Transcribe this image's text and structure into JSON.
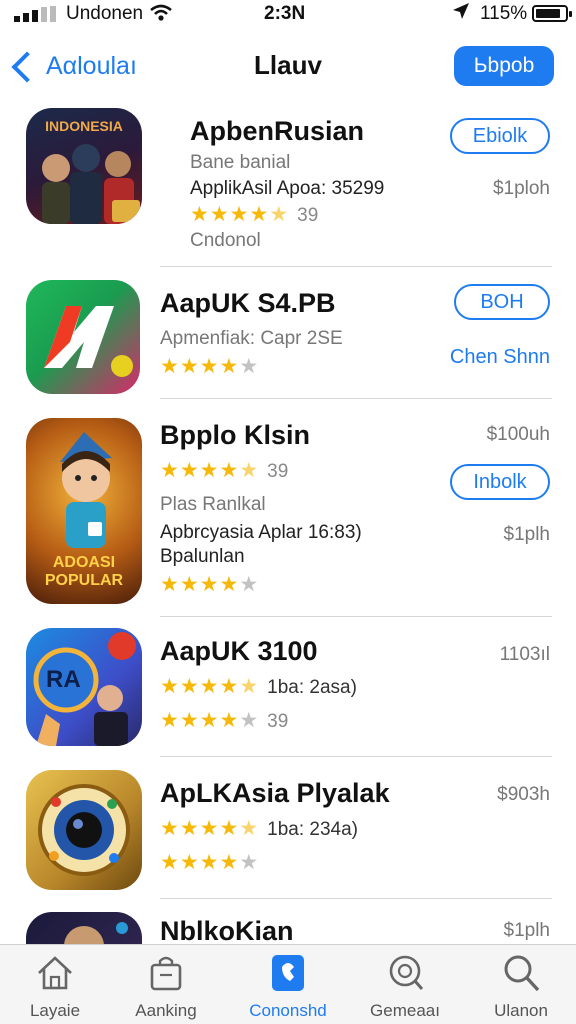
{
  "status_bar": {
    "carrier": "Undonen",
    "time": "2:3Ν",
    "battery": "115%"
  },
  "nav": {
    "back_label": "Aαloulaı",
    "title": "Llauv",
    "action_label": "Ьbpob"
  },
  "apps": [
    {
      "icon_name": "indonesia-game-icon",
      "icon_text": "INDONESIA",
      "name": "ΑpbenRusian",
      "subtitle": "Bane banial",
      "meta": "ApplikAsil Apoa: 35299",
      "rating": 4.5,
      "rating_count": "39",
      "extra": "Cndonol",
      "button": "Ebiolk",
      "price": "$1ploh"
    },
    {
      "icon_name": "red-n-logo-icon",
      "name": "AapUK S4.PB",
      "subtitle": "Apmenfiak: Capr 2SE",
      "rating": 4,
      "button": "BOH",
      "link": "Chen Shnn"
    },
    {
      "icon_name": "adventure-character-icon",
      "icon_text": "ADOASI POPULAR",
      "name": "Bpplo Klsin",
      "rating": 4.5,
      "rating_count": "39",
      "price_top": "$100uh",
      "subtitle": "Plas Ranlkal",
      "meta": "Apbrcyasia Aplar 16:83)",
      "meta2": "Bpalunlan",
      "rating2": 4,
      "button": "Inbolk",
      "price": "$1plh"
    },
    {
      "icon_name": "ra-quiz-icon",
      "icon_text": "RA",
      "name": "AapUK 3100",
      "rating": 4.5,
      "rating_text": "1ba: 2asa)",
      "rating2": 4,
      "rating2_count": "39",
      "price_top": "1103ıl"
    },
    {
      "icon_name": "camera-lens-icon",
      "name": "ApLKAsia Plyalak",
      "rating": 4.5,
      "rating_text": "1ba: 234a)",
      "rating2": 4,
      "price_top": "$903h"
    },
    {
      "icon_name": "partial-app-icon",
      "name": "NblkoKian",
      "price_top": "$1plh"
    }
  ],
  "tabs": [
    {
      "icon": "home-icon",
      "label": "Layaie"
    },
    {
      "icon": "bag-icon",
      "label": "Aanking"
    },
    {
      "icon": "phone-icon",
      "label": "Cononshd"
    },
    {
      "icon": "search-circle-icon",
      "label": "Gemeaaı"
    },
    {
      "icon": "search-icon",
      "label": "Ulanon"
    }
  ],
  "active_tab": 2,
  "colors": {
    "accent": "#1e7cf0",
    "star": "#f6b90a"
  }
}
